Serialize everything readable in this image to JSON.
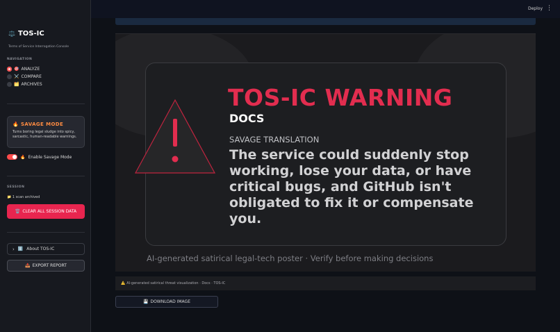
{
  "sidebar": {
    "brand_icon": "⚖️",
    "brand_title": "TOS-IC",
    "brand_subtitle": "Terms of Service Interrogation Console",
    "nav_label": "NAVIGATION",
    "nav_items": [
      {
        "icon": "🎯",
        "label": "ANALYZE",
        "selected": true
      },
      {
        "icon": "⚔️",
        "label": "COMPARE",
        "selected": false
      },
      {
        "icon": "🗂️",
        "label": "ARCHIVES",
        "selected": false
      }
    ],
    "savage_card": {
      "icon": "🔥",
      "title": "SAVAGE MODE",
      "description": "Turns boring legal sludge into spicy, sarcastic, human-readable warnings."
    },
    "savage_toggle": {
      "icon": "🔥",
      "label": "Enable Savage Mode",
      "enabled": true
    },
    "session_label": "SESSION",
    "archived_icon": "📁",
    "archived_text": "1 scan archived",
    "clear_button": {
      "icon": "🗑️",
      "label": "CLEAR ALL SESSION DATA"
    },
    "about": {
      "icon": "ℹ️",
      "label": "About TOS-IC"
    },
    "export_button": {
      "icon": "📤",
      "label": "EXPORT REPORT"
    }
  },
  "topbar": {
    "deploy_label": "Deploy",
    "menu_glyph": "⋮"
  },
  "poster": {
    "title": "TOS-IC WARNING",
    "doc_name": "DOCS",
    "subheading": "SAVAGE TRANSLATION",
    "body": "The service could suddenly stop working, lose your data, or have critical bugs, and GitHub isn't obligated to fix it or compensate you.",
    "caption": "AI-generated satirical legal-tech poster · Verify before making decisions"
  },
  "footnote": {
    "icon": "⚠️",
    "text": "AI-generated satirical threat visualization · Docs · TOS-IC"
  },
  "download_button": {
    "icon": "💾",
    "label": "DOWNLOAD IMAGE"
  },
  "colors": {
    "accent": "#e8254f",
    "warning_red": "#e22d4f",
    "savage_orange": "#ff8c42",
    "background": "#0e1117"
  }
}
